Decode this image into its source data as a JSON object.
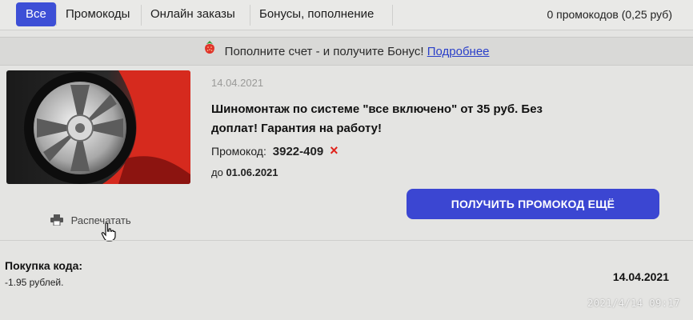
{
  "tabs": [
    {
      "label": "Все",
      "active": true
    },
    {
      "label": "Промокоды",
      "active": false
    },
    {
      "label": "Онлайн заказы",
      "active": false
    },
    {
      "label": "Бонусы, пополнение",
      "active": false
    }
  ],
  "counter": "0 промокодов (0,25 руб)",
  "banner": {
    "icon": "strawberry-icon",
    "text": "Пополните счет - и получите Бонус!",
    "link": "Подробнее"
  },
  "coupon": {
    "image": "car-wheel-image",
    "date": "14.04.2021",
    "title": "Шиномонтаж по системе \"все включено\" от 35 руб. Без доплат! Гарантия на работу!",
    "promo_label": "Промокод:",
    "promo_code": "3922-409",
    "remove_icon": "×",
    "valid_prefix": "до",
    "valid_date": "01.06.2021",
    "get_button": "ПОЛУЧИТЬ ПРОМОКОД ЕЩЁ",
    "print_label": "Распечатать"
  },
  "purchase": {
    "label": "Покупка кода:",
    "amount": "-1.95 рублей.",
    "date": "14.04.2021"
  },
  "photo_timestamp": "2021/4/14 09:17",
  "colors": {
    "accent": "#3b46d2",
    "remove": "#e0231b",
    "link": "#2a3fc9"
  }
}
